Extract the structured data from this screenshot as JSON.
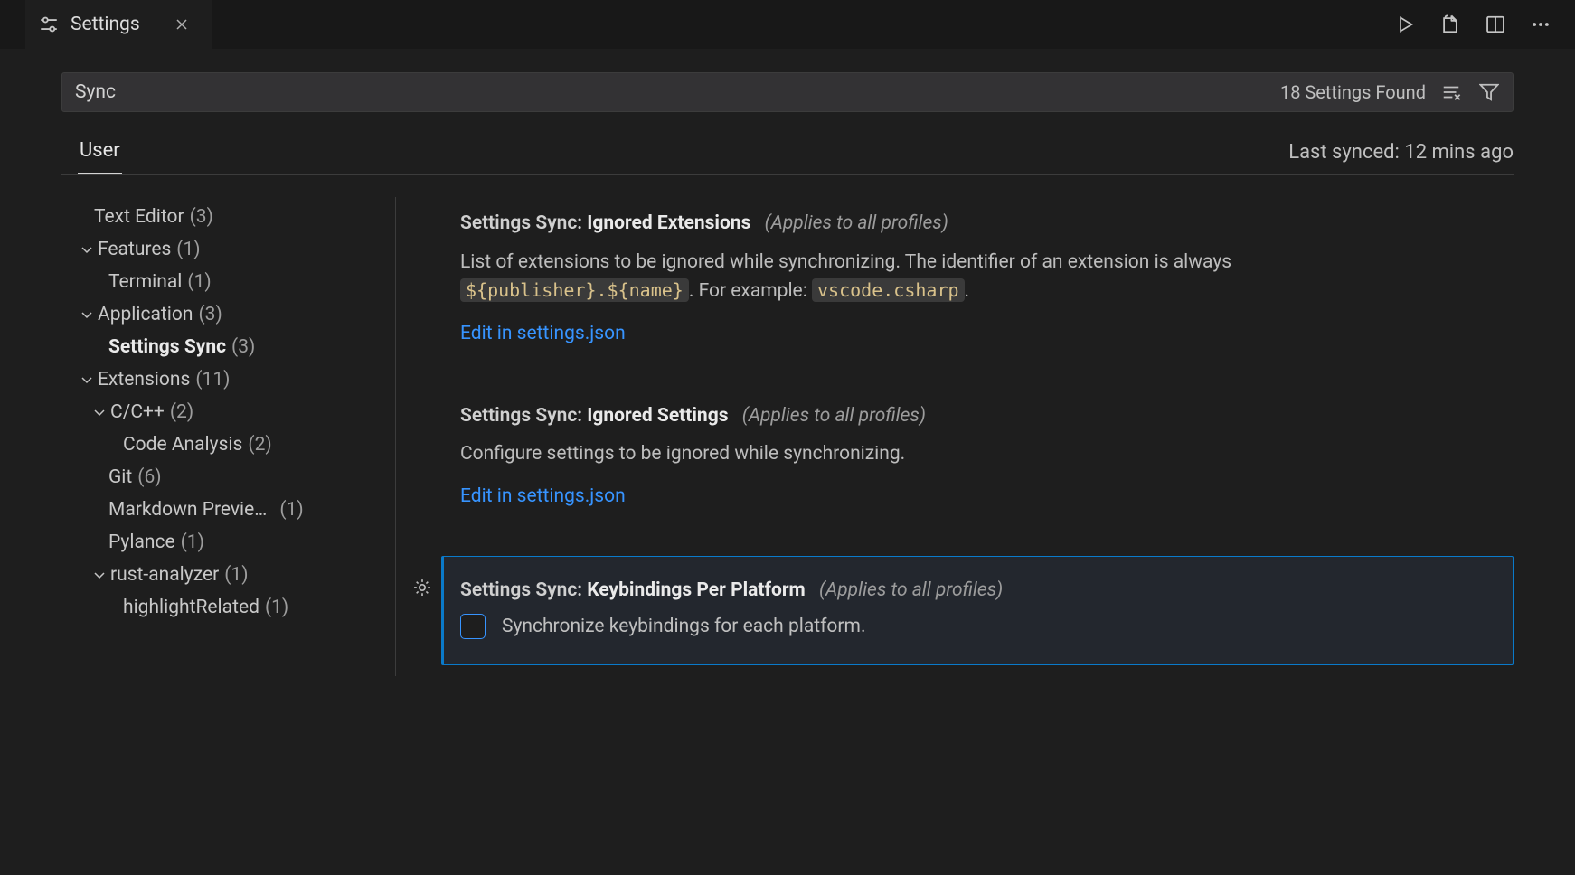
{
  "tab": {
    "title": "Settings"
  },
  "search": {
    "value": "Sync",
    "results_label": "18 Settings Found"
  },
  "scope": {
    "active": "User",
    "status": "Last synced: 12 mins ago"
  },
  "toc": {
    "text_editor": {
      "label": "Text Editor",
      "count": "(3)"
    },
    "features": {
      "label": "Features",
      "count": "(1)"
    },
    "terminal": {
      "label": "Terminal",
      "count": "(1)"
    },
    "application": {
      "label": "Application",
      "count": "(3)"
    },
    "settings_sync": {
      "label": "Settings Sync",
      "count": "(3)"
    },
    "extensions": {
      "label": "Extensions",
      "count": "(11)"
    },
    "ccpp": {
      "label": "C/C++",
      "count": "(2)"
    },
    "code_analysis": {
      "label": "Code Analysis",
      "count": "(2)"
    },
    "git": {
      "label": "Git",
      "count": "(6)"
    },
    "markdown_preview": {
      "label": "Markdown Previe…",
      "count": "(1)"
    },
    "pylance": {
      "label": "Pylance",
      "count": "(1)"
    },
    "rust_analyzer": {
      "label": "rust-analyzer",
      "count": "(1)"
    },
    "highlight_related": {
      "label": "highlightRelated",
      "count": "(1)"
    }
  },
  "settings": {
    "ignored_extensions": {
      "prefix": "Settings Sync:",
      "name": "Ignored Extensions",
      "scope": "(Applies to all profiles)",
      "desc_part1": "List of extensions to be ignored while synchronizing. The identifier of an extension is always ",
      "desc_code1": "${publisher}.${name}",
      "desc_part2": ". For example: ",
      "desc_code2": "vscode.csharp",
      "desc_part3": ".",
      "link": "Edit in settings.json"
    },
    "ignored_settings": {
      "prefix": "Settings Sync:",
      "name": "Ignored Settings",
      "scope": "(Applies to all profiles)",
      "desc": "Configure settings to be ignored while synchronizing.",
      "link": "Edit in settings.json"
    },
    "keybindings": {
      "prefix": "Settings Sync:",
      "name": "Keybindings Per Platform",
      "scope": "(Applies to all profiles)",
      "checkbox_label": "Synchronize keybindings for each platform."
    }
  }
}
